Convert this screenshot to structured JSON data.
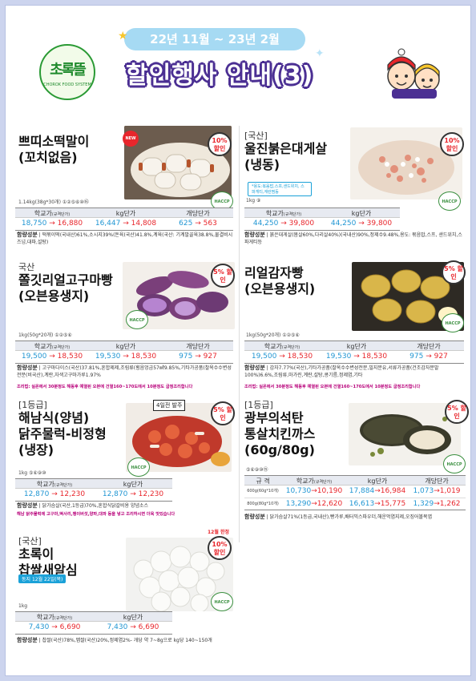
{
  "header": {
    "logo_text": "초록뜰",
    "logo_sub": "CHOROK FOOD SYSTEM",
    "date_range": "22년 11월 ~ 23년 2월",
    "title": "할인행사 안내(3)"
  },
  "colors": {
    "old_price": "#2196d3",
    "new_price": "#e8262c",
    "band": "#a6daf3",
    "title_outline": "#4b2f93"
  },
  "products": [
    {
      "origin": "",
      "name1": "쁘띠소떡말이",
      "name2": "(꼬치없음)",
      "spec": "1.14kg(38g*30개) ①②⑤⑥⑩⑯",
      "badge": "10% 할인",
      "new_badge": "NEW",
      "haccp": "HACCP",
      "headers": [
        "학교가",
        "kg단가",
        "개당단가"
      ],
      "header_sub": "(규격단가)",
      "prices": [
        {
          "old": "18,750",
          "new": "16,880"
        },
        {
          "old": "16,447",
          "new": "14,808"
        },
        {
          "old": "625",
          "new": "563"
        }
      ],
      "ingredient_label": "함량성분",
      "ingredients": "떡볶이떡(국내산)61%,소시지39%(돈육(국산)41.8%,계육(국산: 기계발골육38.8%,물결비시즈넝,대파,설탕)"
    },
    {
      "origin": "[국산]",
      "name1": "울진붉은대게살",
      "name2": "(냉동)",
      "spec": "1kg ⑨",
      "badge": "10% 할인",
      "haccp": "HACCP",
      "tag": "*용도:볶음밥,스프,샌드위치, 스파게티,계란찜등",
      "headers": [
        "학교가",
        "kg단가"
      ],
      "header_sub": "(규격단가)",
      "prices": [
        {
          "old": "44,250",
          "new": "39,800"
        },
        {
          "old": "44,250",
          "new": "39,800"
        }
      ],
      "ingredient_label": "함량성분",
      "ingredients": "붉은대게살(몸살60%,다리살40%)(국내산)90%,정제수9.48%,용도: 볶음밥,스프, 샌드위치,스파게티등"
    },
    {
      "origin": "국산",
      "name1": "쫄깃리얼고구마빵",
      "name2": "(오븐용생지)",
      "spec": "1kg(50g*20개) ①②⑤⑥",
      "badge": "5% 할인",
      "haccp": "HACCP",
      "headers": [
        "학교가",
        "kg단가",
        "개당단가"
      ],
      "header_sub": "(규격단가)",
      "prices": [
        {
          "old": "19,500",
          "new": "18,530"
        },
        {
          "old": "19,530",
          "new": "18,530"
        },
        {
          "old": "975",
          "new": "927"
        }
      ],
      "ingredient_label": "함량성분",
      "ingredients": "고구마다이스(국산)37.81%,혼합제제,조림류(횡음엉금57㎖9.85%,기타가공품(찰옥수수변성전분(비국산),계란,자색고구마가루1.97%",
      "note": "조리법: 실온에서 30분정도 해동후 예열된 오븐에 건열160~170도에서 10분정도 굽정조리합니다"
    },
    {
      "origin": "",
      "name1": "리얼감자빵",
      "name2": "(오븐용생지)",
      "spec": "1kg(50g*20개) ①②⑤⑥",
      "badge": "5% 할인",
      "haccp": "HACCP",
      "headers": [
        "학교가",
        "kg단가",
        "개당단가"
      ],
      "header_sub": "(규격단가)",
      "prices": [
        {
          "old": "19,500",
          "new": "18,530"
        },
        {
          "old": "19,530",
          "new": "18,530"
        },
        {
          "old": "975",
          "new": "927"
        }
      ],
      "ingredient_label": "함량성분",
      "ingredients": "감자7.77%(국산),기타가공품(찰옥수수변성전분,밀지분유,서류가공품(건조감자분말100%)6.6%,조림류,마가린,계란,설탕,콩기름,정제염,기타",
      "note": "조리법: 실온에서 30분정도 해동후 예열된 오븐에 건열160~170도에서 10분정도 굽정조리합니다"
    },
    {
      "origin": "[1등급]",
      "name1": "해남식(양념)",
      "name2": "닭주물럭-비정형",
      "name3": "(냉장)",
      "spec": "1kg ⑤⑥⑨⑩",
      "badge": "5% 할인",
      "haccp": "HACCP",
      "tag2": "4일전 발주",
      "headers": [
        "학교가",
        "kg단가"
      ],
      "header_sub": "(규격단가)",
      "prices": [
        {
          "old": "12,870",
          "new": "12,230"
        },
        {
          "old": "12,870",
          "new": "12,230"
        }
      ],
      "ingredient_label": "함량성분",
      "ingredients": "닭가슴살(국산,1등급)70%,혼합식닭갈비용 양념소스",
      "note": "해남 닭주물럭에 고구마,떡사리,팽이버섯,양파,대파 등을 넣고 조리하시면 더욱 맛있습니다"
    },
    {
      "origin": "[1등급]",
      "name1": "광부의석탄",
      "name2": "통살치킨까스",
      "name3": "(60g/80g)",
      "spec": "⑤⑥⑨⑩⑮",
      "badge": "5% 할인",
      "haccp": "HACCP",
      "headers": [
        "규 격",
        "학교가",
        "kg단가",
        "개당단가"
      ],
      "header_sub": "(규격단가)",
      "rows": [
        {
          "spec": "600g(60g*10개)",
          "prices": [
            {
              "old": "10,730",
              "new": "10,190"
            },
            {
              "old": "17,884",
              "new": "16,984"
            },
            {
              "old": "1,073",
              "new": "1,019"
            }
          ]
        },
        {
          "spec": "800g(80g*10개)",
          "prices": [
            {
              "old": "13,290",
              "new": "12,620"
            },
            {
              "old": "16,613",
              "new": "15,775"
            },
            {
              "old": "1,329",
              "new": "1,262"
            }
          ]
        }
      ],
      "ingredient_label": "함량성분",
      "ingredients": "닭가슴살71%(1등급,국내산),빵가루,배터믹스파우더,해운먹염지제,오징어볼목엽"
    },
    {
      "origin": "[국산]",
      "name1": "초록이",
      "name2": "찹쌀새알심",
      "spec": "1kg",
      "badge": "10% 할인",
      "top_label": "12월 한정",
      "haccp": "HACCP",
      "tag": "동지 12월 22일(목)",
      "headers": [
        "학교가",
        "kg단가"
      ],
      "header_sub": "(규격단가)",
      "prices": [
        {
          "old": "7,430",
          "new": "6,690"
        },
        {
          "old": "7,430",
          "new": "6,690"
        }
      ],
      "ingredient_label": "함량성분",
      "ingredients": "찹쌀(국산)78%,멥쌀(국산)20%,정제염2%- 개당 약 7~8g으로 kg당 140~150개"
    }
  ]
}
